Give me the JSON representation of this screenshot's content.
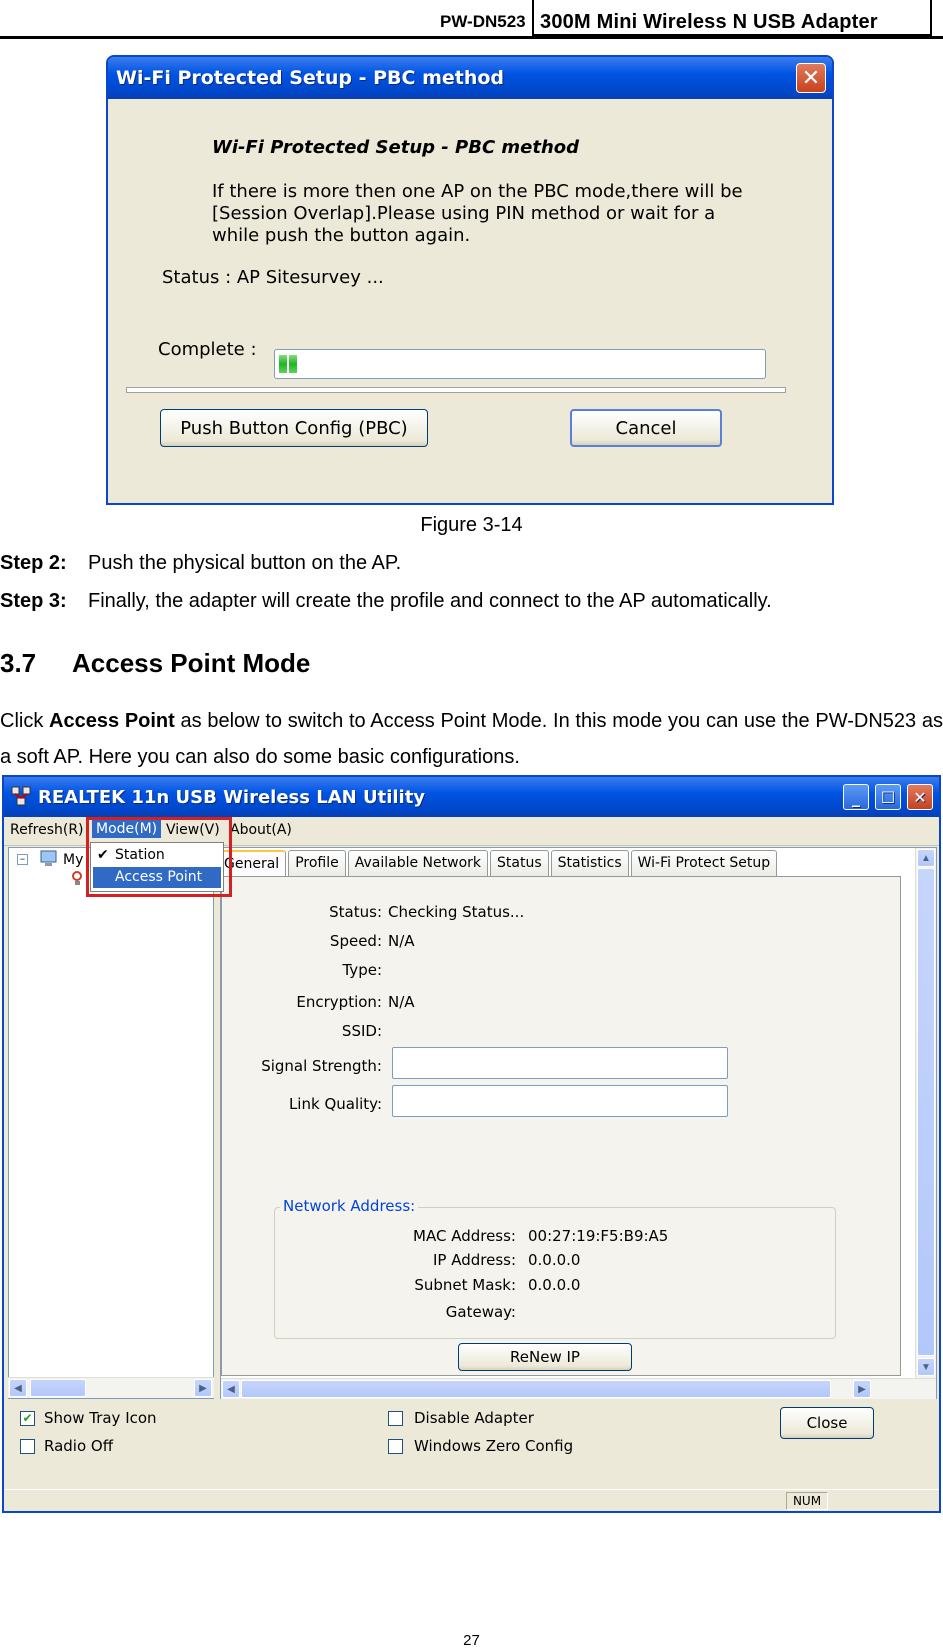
{
  "header": {
    "model": "PW-DN523",
    "title": "300M  Mini  Wireless  N  USB  Adapter"
  },
  "dialog1": {
    "title": "Wi-Fi Protected Setup - PBC method",
    "heading": "Wi-Fi Protected Setup - PBC method",
    "message_lines": [
      "If there is more then one AP on the PBC mode,there will be",
      "[Session Overlap].Please using PIN method or wait for a",
      "while push the button again."
    ],
    "status": "Status : AP Sitesurvey ...",
    "complete_label": "Complete :",
    "progress_blocks": 2,
    "pbc_button": "Push Button Config (PBC)",
    "cancel_button": "Cancel",
    "close_icon": "close-icon"
  },
  "caption": "Figure 3-14",
  "steps": [
    {
      "label": "Step 2:",
      "text": "Push the physical button on the AP."
    },
    {
      "label": "Step 3:",
      "text": "Finally, the adapter will create the profile and connect to the AP automatically."
    }
  ],
  "section": {
    "number": "3.7",
    "title": "Access Point Mode"
  },
  "paragraph": {
    "prefix": "Click ",
    "bold": "Access Point",
    "suffix": " as below to switch to Access Point Mode. In this mode you can use the PW-DN523 as a soft AP. Here you can also do some basic configurations."
  },
  "utility": {
    "title": "REALTEK 11n USB Wireless LAN Utility",
    "menu": [
      "Refresh(R)",
      "Mode(M)",
      "View(V)",
      "About(A)"
    ],
    "dropdown": [
      "Station",
      "Access Point"
    ],
    "tree_label": "My",
    "tabs": [
      "General",
      "Profile",
      "Available Network",
      "Status",
      "Statistics",
      "Wi-Fi Protect Setup"
    ],
    "fields": [
      {
        "label": "Status:",
        "value": "Checking Status..."
      },
      {
        "label": "Speed:",
        "value": "N/A"
      },
      {
        "label": "Type:",
        "value": ""
      },
      {
        "label": "Encryption:",
        "value": "N/A"
      },
      {
        "label": "SSID:",
        "value": ""
      }
    ],
    "signal_label": "Signal Strength:",
    "link_label": "Link Quality:",
    "network_group": "Network Address:",
    "network": [
      {
        "label": "MAC Address:",
        "value": "00:27:19:F5:B9:A5"
      },
      {
        "label": "IP Address:",
        "value": "0.0.0.0"
      },
      {
        "label": "Subnet Mask:",
        "value": "0.0.0.0"
      },
      {
        "label": "Gateway:",
        "value": ""
      }
    ],
    "renew_button": "ReNew IP",
    "show_tray": "Show Tray Icon",
    "radio_off": "Radio Off",
    "disable_adapter": "Disable Adapter",
    "windows_zero": "Windows Zero Config",
    "close_button": "Close",
    "status_num": "NUM"
  },
  "page_number": "27"
}
